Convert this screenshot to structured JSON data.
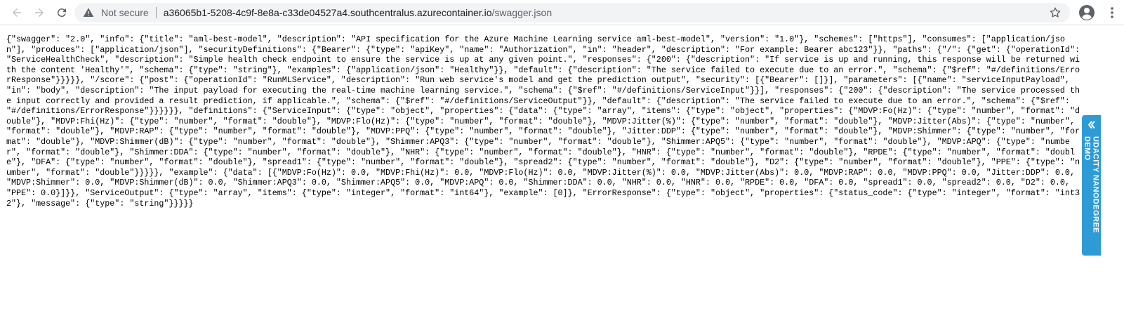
{
  "browser": {
    "security_text": "Not secure",
    "url_host": "a36065b1-5208-4c9f-8e8a-c33de04527a4.southcentralus.azurecontainer.io",
    "url_path": "/swagger.json"
  },
  "page": {
    "json_text": "{\"swagger\": \"2.0\", \"info\": {\"title\": \"aml-best-model\", \"description\": \"API specification for the Azure Machine Learning service aml-best-model\", \"version\": \"1.0\"}, \"schemes\": [\"https\"], \"consumes\": [\"application/json\"], \"produces\": [\"application/json\"], \"securityDefinitions\": {\"Bearer\": {\"type\": \"apiKey\", \"name\": \"Authorization\", \"in\": \"header\", \"description\": \"For example: Bearer abc123\"}}, \"paths\": {\"/\": {\"get\": {\"operationId\": \"ServiceHealthCheck\", \"description\": \"Simple health check endpoint to ensure the service is up at any given point.\", \"responses\": {\"200\": {\"description\": \"If service is up and running, this response will be returned with the content 'Healthy'\", \"schema\": {\"type\": \"string\"}, \"examples\": {\"application/json\": \"Healthy\"}}, \"default\": {\"description\": \"The service failed to execute due to an error.\", \"schema\": {\"$ref\": \"#/definitions/ErrorResponse\"}}}}}, \"/score\": {\"post\": {\"operationId\": \"RunMLService\", \"description\": \"Run web service's model and get the prediction output\", \"security\": [{\"Bearer\": []}], \"parameters\": [{\"name\": \"serviceInputPayload\", \"in\": \"body\", \"description\": \"The input payload for executing the real-time machine learning service.\", \"schema\": {\"$ref\": \"#/definitions/ServiceInput\"}}], \"responses\": {\"200\": {\"description\": \"The service processed the input correctly and provided a result prediction, if applicable.\", \"schema\": {\"$ref\": \"#/definitions/ServiceOutput\"}}, \"default\": {\"description\": \"The service failed to execute due to an error.\", \"schema\": {\"$ref\": \"#/definitions/ErrorResponse\"}}}}}}, \"definitions\": {\"ServiceInput\": {\"type\": \"object\", \"properties\": {\"data\": {\"type\": \"array\", \"items\": {\"type\": \"object\", \"properties\": {\"MDVP:Fo(Hz)\": {\"type\": \"number\", \"format\": \"double\"}, \"MDVP:Fhi(Hz)\": {\"type\": \"number\", \"format\": \"double\"}, \"MDVP:Flo(Hz)\": {\"type\": \"number\", \"format\": \"double\"}, \"MDVP:Jitter(%)\": {\"type\": \"number\", \"format\": \"double\"}, \"MDVP:Jitter(Abs)\": {\"type\": \"number\", \"format\": \"double\"}, \"MDVP:RAP\": {\"type\": \"number\", \"format\": \"double\"}, \"MDVP:PPQ\": {\"type\": \"number\", \"format\": \"double\"}, \"Jitter:DDP\": {\"type\": \"number\", \"format\": \"double\"}, \"MDVP:Shimmer\": {\"type\": \"number\", \"format\": \"double\"}, \"MDVP:Shimmer(dB)\": {\"type\": \"number\", \"format\": \"double\"}, \"Shimmer:APQ3\": {\"type\": \"number\", \"format\": \"double\"}, \"Shimmer:APQ5\": {\"type\": \"number\", \"format\": \"double\"}, \"MDVP:APQ\": {\"type\": \"number\", \"format\": \"double\"}, \"Shimmer:DDA\": {\"type\": \"number\", \"format\": \"double\"}, \"NHR\": {\"type\": \"number\", \"format\": \"double\"}, \"HNR\": {\"type\": \"number\", \"format\": \"double\"}, \"RPDE\": {\"type\": \"number\", \"format\": \"double\"}, \"DFA\": {\"type\": \"number\", \"format\": \"double\"}, \"spread1\": {\"type\": \"number\", \"format\": \"double\"}, \"spread2\": {\"type\": \"number\", \"format\": \"double\"}, \"D2\": {\"type\": \"number\", \"format\": \"double\"}, \"PPE\": {\"type\": \"number\", \"format\": \"double\"}}}}}, \"example\": {\"data\": [{\"MDVP:Fo(Hz)\": 0.0, \"MDVP:Fhi(Hz)\": 0.0, \"MDVP:Flo(Hz)\": 0.0, \"MDVP:Jitter(%)\": 0.0, \"MDVP:Jitter(Abs)\": 0.0, \"MDVP:RAP\": 0.0, \"MDVP:PPQ\": 0.0, \"Jitter:DDP\": 0.0, \"MDVP:Shimmer\": 0.0, \"MDVP:Shimmer(dB)\": 0.0, \"Shimmer:APQ3\": 0.0, \"Shimmer:APQ5\": 0.0, \"MDVP:APQ\": 0.0, \"Shimmer:DDA\": 0.0, \"NHR\": 0.0, \"HNR\": 0.0, \"RPDE\": 0.0, \"DFA\": 0.0, \"spread1\": 0.0, \"spread2\": 0.0, \"D2\": 0.0, \"PPE\": 0.0}]}}, \"ServiceOutput\": {\"type\": \"array\", \"items\": {\"type\": \"integer\", \"format\": \"int64\"}, \"example\": [0]}, \"ErrorResponse\": {\"type\": \"object\", \"properties\": {\"status_code\": {\"type\": \"integer\", \"format\": \"int32\"}, \"message\": {\"type\": \"string\"}}}}}"
  },
  "side_tab": {
    "label": "UDACITY NANODEGREE DEMO",
    "color": "#2e9bd6"
  },
  "icons": [
    "back-icon",
    "forward-icon",
    "reload-icon",
    "warning-icon",
    "star-icon",
    "profile-icon",
    "menu-icon",
    "chevron-icon"
  ]
}
